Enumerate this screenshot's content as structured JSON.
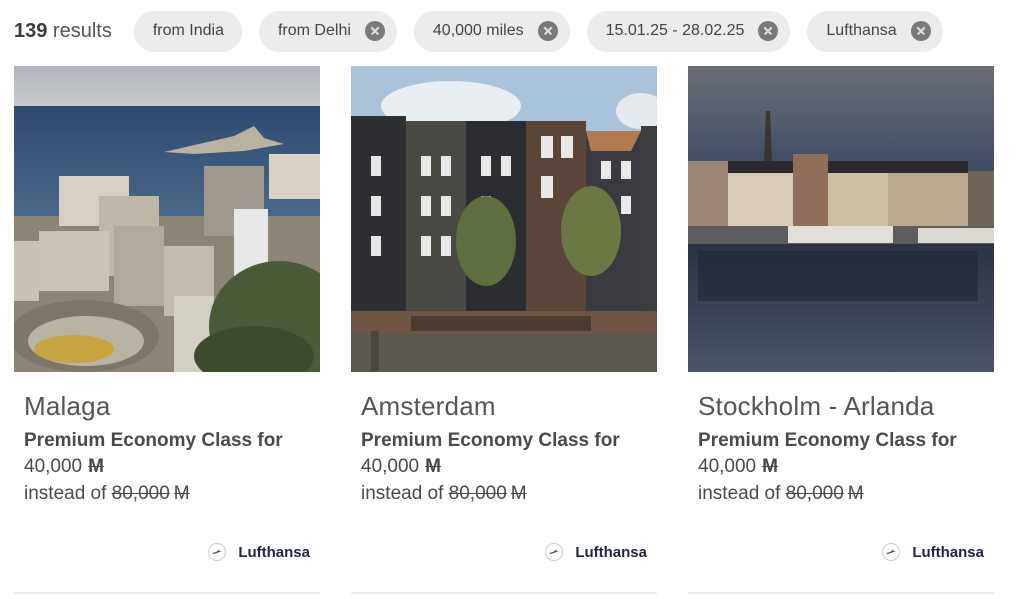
{
  "results": {
    "count": "139",
    "label": " results"
  },
  "filters": [
    {
      "label": "from India",
      "removable": false
    },
    {
      "label": "from Delhi",
      "removable": true
    },
    {
      "label": "40,000 miles",
      "removable": true
    },
    {
      "label": "15.01.25 - 28.02.25",
      "removable": true
    },
    {
      "label": "Lufthansa",
      "removable": true
    }
  ],
  "cards": [
    {
      "city": "Malaga",
      "offer": "Premium Economy Class for",
      "price": "40,000",
      "currency_symbol": "M",
      "instead_of_label": "instead of ",
      "old_price": "80,000",
      "airline": "Lufthansa",
      "image": "malaga-photo"
    },
    {
      "city": "Amsterdam",
      "offer": "Premium Economy Class for",
      "price": "40,000",
      "currency_symbol": "M",
      "instead_of_label": "instead of ",
      "old_price": "80,000",
      "airline": "Lufthansa",
      "image": "amsterdam-photo"
    },
    {
      "city": "Stockholm - Arlanda",
      "offer": "Premium Economy Class for",
      "price": "40,000",
      "currency_symbol": "M",
      "instead_of_label": "instead of ",
      "old_price": "80,000",
      "airline": "Lufthansa",
      "image": "stockholm-photo"
    }
  ],
  "colors": {
    "chip_bg": "#ececec",
    "chip_close": "#7a7a7a",
    "text": "#4a4a4a",
    "airline_text": "#1f2440"
  }
}
